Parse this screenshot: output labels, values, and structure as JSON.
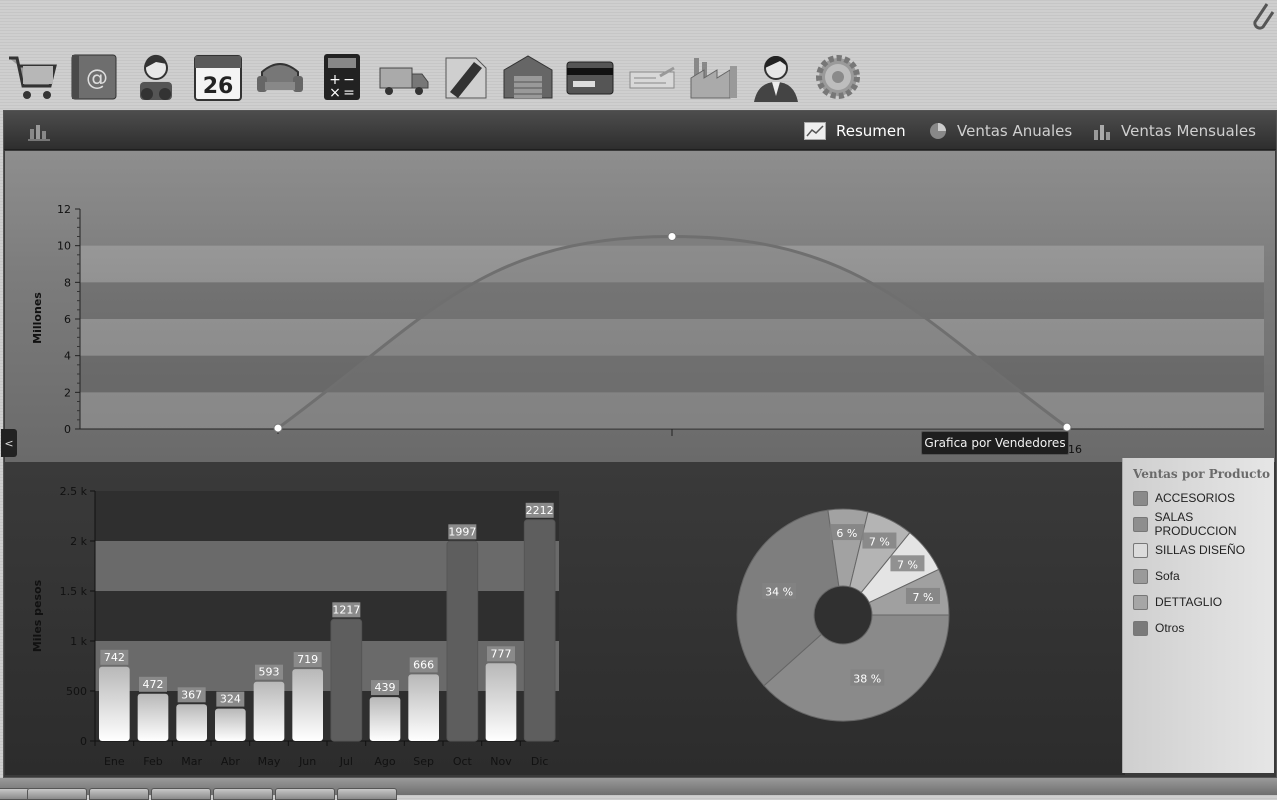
{
  "toolbar": {
    "icons": [
      "shopping-cart-icon",
      "address-book-icon",
      "user-binoculars-icon",
      "calendar-icon",
      "armchair-icon",
      "calculator-icon",
      "delivery-truck-icon",
      "pencil-paper-icon",
      "warehouse-icon",
      "credit-card-icon",
      "check-form-icon",
      "factory-icon",
      "user-icon",
      "gear-icon"
    ],
    "calendar_day": "26"
  },
  "nav": {
    "tabs": [
      {
        "label": "Resumen",
        "icon": "line-chart-icon"
      },
      {
        "label": "Ventas Anuales",
        "icon": "pie-chart-icon"
      },
      {
        "label": "Ventas Mensuales",
        "icon": "bar-chart-icon"
      }
    ],
    "active_tab": "Resumen"
  },
  "collapse_label": "<",
  "tooltip": "Grafica por Vendedores",
  "chart_data": [
    {
      "type": "area",
      "ylabel": "Millones",
      "ylim": [
        0,
        12
      ],
      "yticks": [
        "0",
        "2",
        "4",
        "6",
        "8",
        "10",
        "12"
      ],
      "x_tick_label": "16",
      "points": [
        [
          0,
          0.05
        ],
        [
          1,
          10.5
        ],
        [
          2,
          0.1
        ]
      ],
      "grid": "alternating horizontal bands"
    },
    {
      "type": "bar",
      "ylabel": "Miles pesos",
      "ylim": [
        0,
        2500
      ],
      "yticks": [
        "0",
        "500",
        "1 k",
        "1.5 k",
        "2 k",
        "2.5 k"
      ],
      "categories": [
        "Ene",
        "Feb",
        "Mar",
        "Abr",
        "May",
        "Jun",
        "Jul",
        "Ago",
        "Sep",
        "Oct",
        "Nov",
        "Dic"
      ],
      "values": [
        742,
        472,
        367,
        324,
        593,
        719,
        1217,
        439,
        666,
        1997,
        777,
        2212
      ],
      "highlighted": [
        false,
        false,
        false,
        false,
        false,
        false,
        true,
        false,
        false,
        true,
        false,
        true
      ]
    },
    {
      "type": "pie",
      "variant": "donut",
      "title": "Ventas por Producto",
      "series": [
        {
          "name": "ACCESORIOS",
          "value": 38,
          "label": "38 %"
        },
        {
          "name": "SALAS PRODUCCION",
          "value": 34,
          "label": "34 %"
        },
        {
          "name": "SILLAS DISEÑO",
          "value": 6,
          "label": "6 %"
        },
        {
          "name": "Sofa",
          "value": 7,
          "label": "7 %"
        },
        {
          "name": "DETTAGLIO",
          "value": 7,
          "label": "7 %"
        },
        {
          "name": "Otros",
          "value": 7,
          "label": "7 %"
        }
      ]
    }
  ],
  "legend": {
    "title": "Ventas por Producto",
    "items": [
      {
        "label": "ACCESORIOS",
        "color": "#8a8a8a"
      },
      {
        "label": "SALAS PRODUCCION",
        "color": "#8e8e8e"
      },
      {
        "label": "SILLAS DISEÑO",
        "color": "#dcdcdc"
      },
      {
        "label": "Sofa",
        "color": "#9a9a9a"
      },
      {
        "label": "DETTAGLIO",
        "color": "#a6a6a6"
      },
      {
        "label": "Otros",
        "color": "#7a7a7a"
      }
    ]
  }
}
